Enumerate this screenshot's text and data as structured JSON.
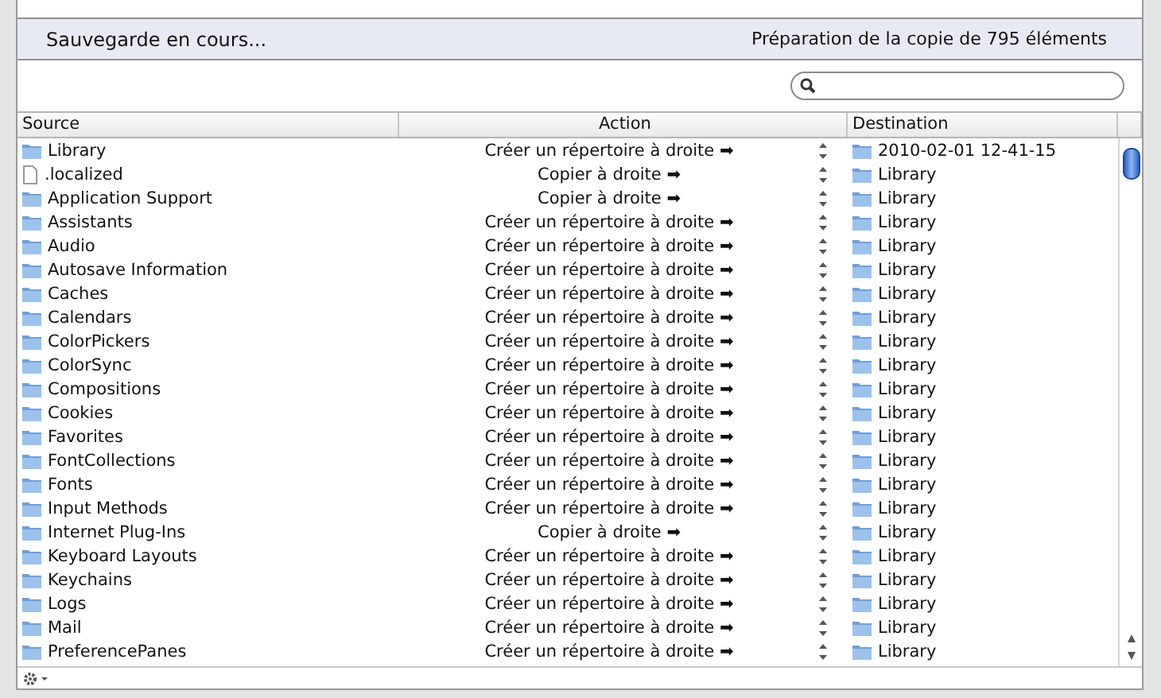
{
  "status": {
    "title": "Sauvegarde en cours...",
    "detail": "Préparation de la copie de 795 éléments"
  },
  "table": {
    "columns": [
      "Source",
      "Action",
      "Destination"
    ],
    "rows": [
      {
        "kind": "folder",
        "source": "Library",
        "action": "Créer un répertoire à droite ➡",
        "destination": "2010-02-01 12-41-15"
      },
      {
        "kind": "file",
        "source": ".localized",
        "action": "Copier à droite ➡",
        "destination": "Library"
      },
      {
        "kind": "folder",
        "source": "Application Support",
        "action": "Copier à droite ➡",
        "destination": "Library"
      },
      {
        "kind": "folder",
        "source": "Assistants",
        "action": "Créer un répertoire à droite ➡",
        "destination": "Library"
      },
      {
        "kind": "folder",
        "source": "Audio",
        "action": "Créer un répertoire à droite ➡",
        "destination": "Library"
      },
      {
        "kind": "folder",
        "source": "Autosave Information",
        "action": "Créer un répertoire à droite ➡",
        "destination": "Library"
      },
      {
        "kind": "folder",
        "source": "Caches",
        "action": "Créer un répertoire à droite ➡",
        "destination": "Library"
      },
      {
        "kind": "folder",
        "source": "Calendars",
        "action": "Créer un répertoire à droite ➡",
        "destination": "Library"
      },
      {
        "kind": "folder",
        "source": "ColorPickers",
        "action": "Créer un répertoire à droite ➡",
        "destination": "Library"
      },
      {
        "kind": "folder",
        "source": "ColorSync",
        "action": "Créer un répertoire à droite ➡",
        "destination": "Library"
      },
      {
        "kind": "folder",
        "source": "Compositions",
        "action": "Créer un répertoire à droite ➡",
        "destination": "Library"
      },
      {
        "kind": "folder",
        "source": "Cookies",
        "action": "Créer un répertoire à droite ➡",
        "destination": "Library"
      },
      {
        "kind": "folder",
        "source": "Favorites",
        "action": "Créer un répertoire à droite ➡",
        "destination": "Library"
      },
      {
        "kind": "folder",
        "source": "FontCollections",
        "action": "Créer un répertoire à droite ➡",
        "destination": "Library"
      },
      {
        "kind": "folder",
        "source": "Fonts",
        "action": "Créer un répertoire à droite ➡",
        "destination": "Library"
      },
      {
        "kind": "folder",
        "source": "Input Methods",
        "action": "Créer un répertoire à droite ➡",
        "destination": "Library"
      },
      {
        "kind": "folder",
        "source": "Internet Plug-Ins",
        "action": "Copier à droite ➡",
        "destination": "Library"
      },
      {
        "kind": "folder",
        "source": "Keyboard Layouts",
        "action": "Créer un répertoire à droite ➡",
        "destination": "Library"
      },
      {
        "kind": "folder",
        "source": "Keychains",
        "action": "Créer un répertoire à droite ➡",
        "destination": "Library"
      },
      {
        "kind": "folder",
        "source": "Logs",
        "action": "Créer un répertoire à droite ➡",
        "destination": "Library"
      },
      {
        "kind": "folder",
        "source": "Mail",
        "action": "Créer un répertoire à droite ➡",
        "destination": "Library"
      },
      {
        "kind": "folder",
        "source": "PreferencePanes",
        "action": "Créer un répertoire à droite ➡",
        "destination": "Library"
      }
    ]
  }
}
